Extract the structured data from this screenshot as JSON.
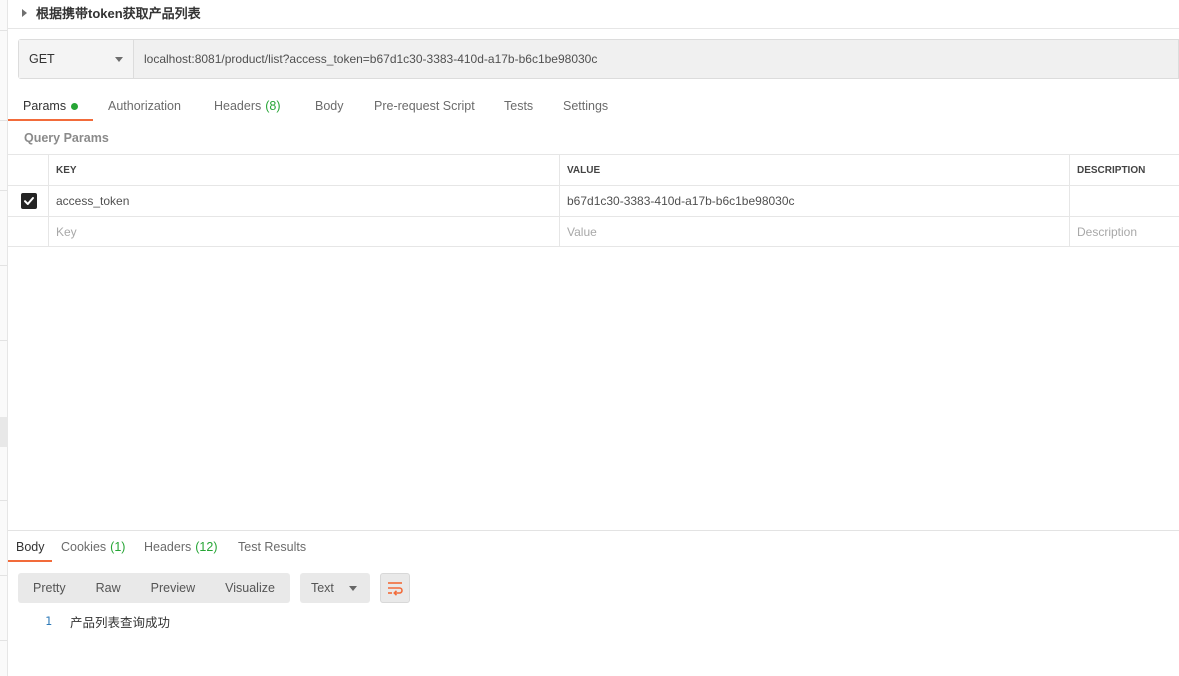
{
  "request": {
    "title": "根据携带token获取产品列表",
    "method": "GET",
    "url": "localhost:8081/product/list?access_token=b67d1c30-3383-410d-a17b-b6c1be98030c"
  },
  "request_tabs": [
    {
      "label": "Params",
      "active": true,
      "indicator": "green-dot"
    },
    {
      "label": "Authorization"
    },
    {
      "label": "Headers",
      "count": "(8)"
    },
    {
      "label": "Body"
    },
    {
      "label": "Pre-request Script"
    },
    {
      "label": "Tests"
    },
    {
      "label": "Settings"
    }
  ],
  "query_params": {
    "section_title": "Query Params",
    "headers": {
      "key": "KEY",
      "value": "VALUE",
      "description": "DESCRIPTION"
    },
    "rows": [
      {
        "checked": true,
        "key": "access_token",
        "value": "b67d1c30-3383-410d-a17b-b6c1be98030c",
        "description": ""
      }
    ],
    "placeholders": {
      "key": "Key",
      "value": "Value",
      "description": "Description"
    }
  },
  "response_tabs": [
    {
      "label": "Body",
      "active": true
    },
    {
      "label": "Cookies",
      "count": "(1)"
    },
    {
      "label": "Headers",
      "count": "(12)"
    },
    {
      "label": "Test Results"
    }
  ],
  "response_toolbar": {
    "view_modes": [
      "Pretty",
      "Raw",
      "Preview",
      "Visualize"
    ],
    "format": "Text",
    "wrap_icon": "wrap-lines-icon"
  },
  "response_body": {
    "lines": [
      {
        "number": "1",
        "text": "产品列表查询成功"
      }
    ]
  },
  "colors": {
    "accent": "#f26b3a",
    "count_green": "#26a535",
    "line_number": "#2e7ab8"
  }
}
